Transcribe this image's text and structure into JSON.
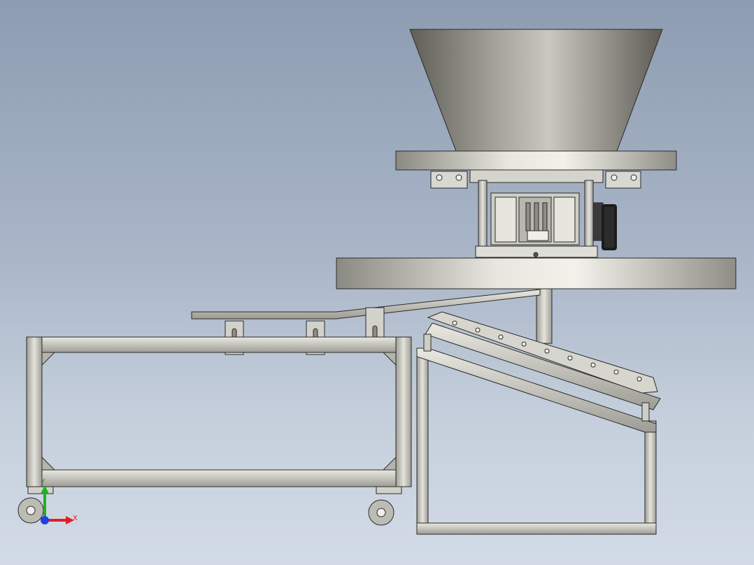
{
  "viewport": {
    "background_top": "#8e9cb2",
    "background_bottom": "#d2dbe6"
  },
  "colors": {
    "metal": "#c9c7bf",
    "metal_dark": "#7d7b72",
    "edge": "#2a2a2a",
    "pulley": "#1c1c1c"
  },
  "triad": {
    "x_label": "X",
    "y_label": "Y",
    "x_color": "#e02020",
    "y_color": "#20b020",
    "z_color": "#2040e0"
  }
}
